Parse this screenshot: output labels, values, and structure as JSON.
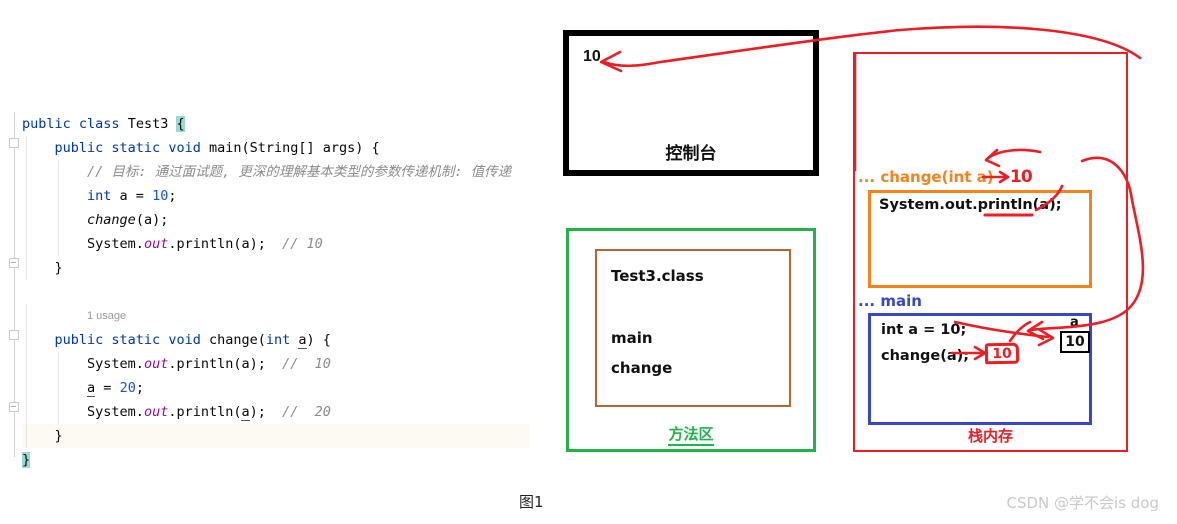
{
  "editor": {
    "lines": [
      {
        "indent": 0,
        "tokens": [
          {
            "t": "public ",
            "c": "kw"
          },
          {
            "t": "class ",
            "c": "kw"
          },
          {
            "t": "Test3 ",
            "c": "cls"
          },
          {
            "t": "{",
            "c": "brace-hl"
          }
        ]
      },
      {
        "indent": 1,
        "tokens": [
          {
            "t": "public ",
            "c": "kw"
          },
          {
            "t": "static ",
            "c": "kw"
          },
          {
            "t": "void ",
            "c": "kw"
          },
          {
            "t": "main",
            "c": "mth"
          },
          {
            "t": "(",
            "c": ""
          },
          {
            "t": "String",
            "c": "cls"
          },
          {
            "t": "[] args) {",
            "c": ""
          }
        ]
      },
      {
        "indent": 2,
        "tokens": [
          {
            "t": "// 目标: 通过面试题, 更深的理解基本类型的参数传递机制: 值传递",
            "c": "cmt"
          }
        ]
      },
      {
        "indent": 2,
        "tokens": [
          {
            "t": "int ",
            "c": "kw"
          },
          {
            "t": "a = ",
            "c": ""
          },
          {
            "t": "10",
            "c": "num"
          },
          {
            "t": ";",
            "c": ""
          }
        ]
      },
      {
        "indent": 2,
        "tokens": [
          {
            "t": "change",
            "c": "static-m"
          },
          {
            "t": "(a);",
            "c": ""
          }
        ]
      },
      {
        "indent": 2,
        "tokens": [
          {
            "t": "System.",
            "c": ""
          },
          {
            "t": "out",
            "c": "field"
          },
          {
            "t": ".println(a);",
            "c": ""
          },
          {
            "t": "  // 10",
            "c": "cmt-inline"
          }
        ]
      },
      {
        "indent": 1,
        "tokens": [
          {
            "t": "}",
            "c": ""
          }
        ]
      },
      {
        "indent": 0,
        "tokens": []
      },
      {
        "indent": 1,
        "tokens": []
      },
      {
        "indent": 1,
        "tokens": [
          {
            "t": "public ",
            "c": "kw"
          },
          {
            "t": "static ",
            "c": "kw"
          },
          {
            "t": "void ",
            "c": "kw"
          },
          {
            "t": "change",
            "c": "mth"
          },
          {
            "t": "(",
            "c": ""
          },
          {
            "t": "int ",
            "c": "kw"
          },
          {
            "t": "a",
            "c": "ident-u"
          },
          {
            "t": ") {",
            "c": ""
          }
        ]
      },
      {
        "indent": 2,
        "tokens": [
          {
            "t": "System.",
            "c": ""
          },
          {
            "t": "out",
            "c": "field"
          },
          {
            "t": ".println(a);",
            "c": ""
          },
          {
            "t": "  //  10",
            "c": "cmt-inline"
          }
        ]
      },
      {
        "indent": 2,
        "tokens": [
          {
            "t": "a",
            "c": "ident-u"
          },
          {
            "t": " = ",
            "c": ""
          },
          {
            "t": "20",
            "c": "num"
          },
          {
            "t": ";",
            "c": ""
          }
        ]
      },
      {
        "indent": 2,
        "tokens": [
          {
            "t": "System.",
            "c": ""
          },
          {
            "t": "out",
            "c": "field"
          },
          {
            "t": ".println(",
            "c": ""
          },
          {
            "t": "a",
            "c": "ident-u"
          },
          {
            "t": ");",
            "c": ""
          },
          {
            "t": "  //  20",
            "c": "cmt-inline"
          }
        ]
      },
      {
        "indent": 1,
        "tokens": [
          {
            "t": "}",
            "c": ""
          }
        ]
      },
      {
        "indent": 0,
        "tokens": [
          {
            "t": "}",
            "c": "brace-hl"
          }
        ]
      }
    ],
    "usage_hint": "1 usage",
    "usage_hint_line": 8
  },
  "console": {
    "output_value": "10",
    "label": "控制台"
  },
  "method_area": {
    "label": "方法区",
    "class_entries": [
      "Test3.class",
      "main",
      "change"
    ]
  },
  "stack_memory": {
    "label": "栈内存",
    "frames": [
      {
        "title": "... change(int a)",
        "param_arrow": "→",
        "param_value": "10",
        "statements": [
          "System.out.println(a);"
        ]
      },
      {
        "title": "... main",
        "statements": [
          "int a = 10;",
          "change(a);"
        ],
        "arg_value_badge": "10",
        "variable": {
          "name": "a",
          "value": "10"
        }
      }
    ]
  },
  "captions": {
    "figure": "图1",
    "watermark": "CSDN @学不会is dog"
  },
  "colors": {
    "console_border": "#000000",
    "method_area_border": "#22b14c",
    "class_box_border": "#b5672f",
    "stack_border": "#ee1c25",
    "change_frame": "#f7821b",
    "main_frame": "#3b46c4",
    "annotation_red": "#ee1c25",
    "keyword_blue": "#0033b3",
    "number_blue": "#1750eb",
    "comment_gray": "#8c8c8c",
    "field_purple": "#871094"
  }
}
